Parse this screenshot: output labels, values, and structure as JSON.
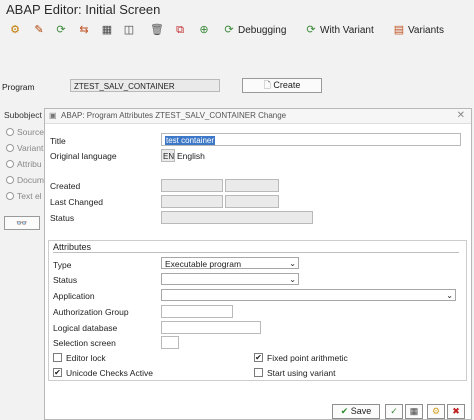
{
  "window": {
    "title": "ABAP Editor: Initial Screen"
  },
  "toolbar": {
    "debugging": "Debugging",
    "with_variant": "With Variant",
    "variants": "Variants"
  },
  "main": {
    "program_label": "Program",
    "program_value": "ZTEST_SALV_CONTAINER",
    "create_button": "Create",
    "subobjects_label": "Subobject",
    "subobjects": [
      "Source",
      "Variant",
      "Attribu",
      "Docum",
      "Text el"
    ]
  },
  "dialog": {
    "title": "ABAP: Program Attributes ZTEST_SALV_CONTAINER Change",
    "title_label": "Title",
    "title_value": "test container",
    "orig_lang_label": "Original language",
    "orig_lang_code": "EN",
    "orig_lang_name": "English",
    "created_label": "Created",
    "last_changed_label": "Last Changed",
    "status_label": "Status",
    "attributes_header": "Attributes",
    "type_label": "Type",
    "type_value": "Executable program",
    "status2_label": "Status",
    "application_label": "Application",
    "auth_group_label": "Authorization Group",
    "logical_db_label": "Logical database",
    "selection_screen_label": "Selection screen",
    "editor_lock_label": "Editor lock",
    "fixed_point_label": "Fixed point arithmetic",
    "unicode_label": "Unicode Checks Active",
    "start_variant_label": "Start using variant",
    "editor_lock_checked": false,
    "fixed_point_checked": true,
    "unicode_checked": true,
    "start_variant_checked": false,
    "save_button": "Save"
  }
}
